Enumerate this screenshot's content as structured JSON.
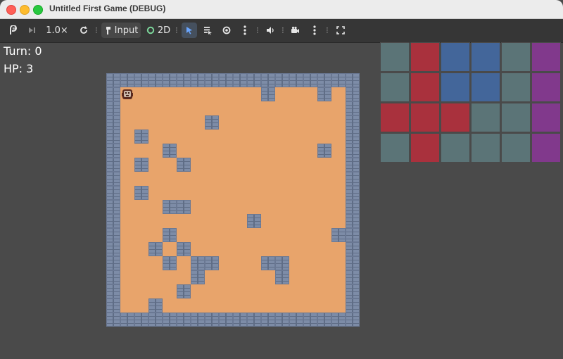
{
  "window": {
    "title": "Untitled First Game (DEBUG)"
  },
  "toolbar": {
    "speed_label": "1.0×",
    "input_label": "Input",
    "view2d_label": "2D"
  },
  "hud": {
    "turn_text": "Turn: 0",
    "hp_text": "HP: 3"
  },
  "icons": {
    "close": "close-window-icon",
    "minimize": "minimize-window-icon",
    "maximize": "maximize-window-icon",
    "pause": "pause-game-icon",
    "step": "next-frame-icon",
    "reset": "reset-icon",
    "input": "input-icon",
    "view2d": "view-2d-icon",
    "select": "select-arrow-icon",
    "list": "list-select-icon",
    "visibility": "eye-icon",
    "more": "more-vertical-icon",
    "audio": "speaker-icon",
    "camera": "camera-icon",
    "fullscreen": "fullscreen-icon",
    "player": "player-sprite-icon"
  },
  "colors": {
    "floor": "#e8a46b",
    "wall": "#7d8ca7",
    "tile_slate": "#5b7477",
    "tile_red": "#a9313d",
    "tile_blue": "#43669a",
    "tile_purple": "#81398c"
  },
  "board": {
    "cols": 18,
    "rows": 18,
    "walls": [
      [
        11,
        1
      ],
      [
        15,
        1
      ],
      [
        7,
        3
      ],
      [
        2,
        4
      ],
      [
        4,
        5
      ],
      [
        15,
        5
      ],
      [
        2,
        6
      ],
      [
        5,
        6
      ],
      [
        2,
        8
      ],
      [
        4,
        9
      ],
      [
        5,
        9
      ],
      [
        10,
        10
      ],
      [
        4,
        11
      ],
      [
        16,
        11
      ],
      [
        3,
        12
      ],
      [
        5,
        12
      ],
      [
        4,
        13
      ],
      [
        6,
        13
      ],
      [
        7,
        13
      ],
      [
        11,
        13
      ],
      [
        12,
        13
      ],
      [
        6,
        14
      ],
      [
        12,
        14
      ],
      [
        5,
        15
      ],
      [
        3,
        16
      ]
    ],
    "player": [
      1,
      1
    ]
  },
  "tile_panel": {
    "cols": 6,
    "rows": 4,
    "tiles": [
      [
        "slate",
        "red",
        "blue",
        "blue",
        "slate",
        "purple"
      ],
      [
        "slate",
        "red",
        "blue",
        "blue",
        "slate",
        "purple"
      ],
      [
        "red",
        "red",
        "red",
        "slate",
        "slate",
        "purple"
      ],
      [
        "slate",
        "red",
        "slate",
        "slate",
        "slate",
        "purple"
      ]
    ]
  }
}
